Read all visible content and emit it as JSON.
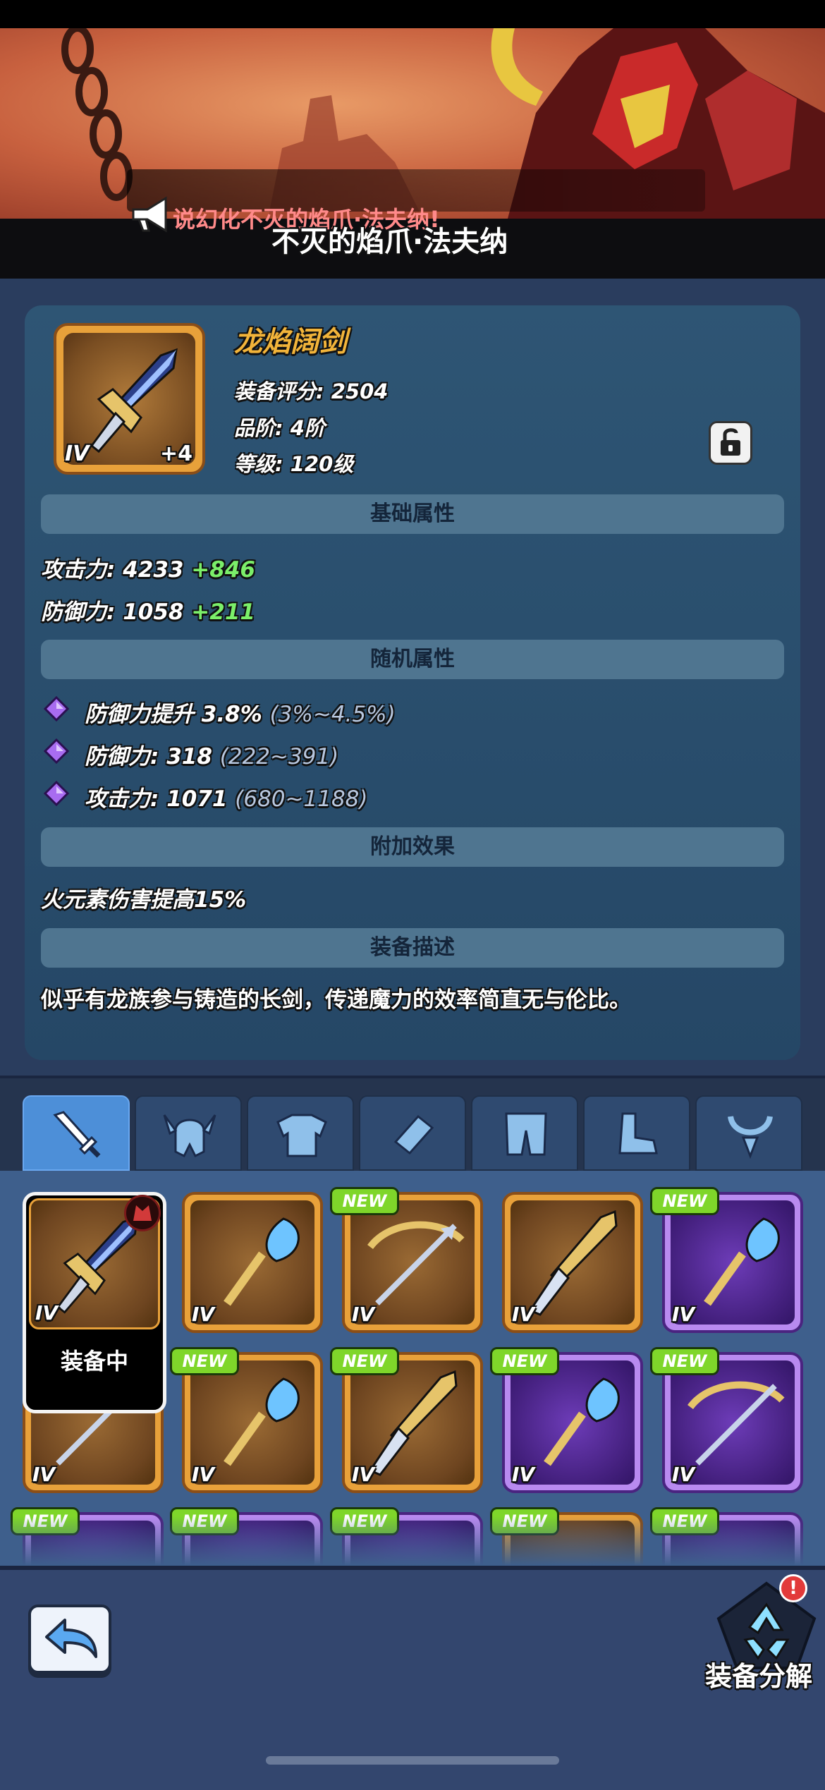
{
  "banner": {
    "announcement": "说幻化不灭的焰爪·法夫纳!",
    "subtitle": "不灭的焰爪·法夫纳"
  },
  "item": {
    "name": "龙焰阔剑",
    "tier": "IV",
    "enhance": "+4",
    "score_label": "装备评分:",
    "score_value": "2504",
    "grade_label": "品阶:",
    "grade_value": "4阶",
    "level_label": "等级:",
    "level_value": "120级",
    "icon": "sword-icon"
  },
  "sections": {
    "base": "基础属性",
    "random": "随机属性",
    "extra": "附加效果",
    "desc": "装备描述"
  },
  "base_stats": [
    {
      "label": "攻击力:",
      "value": "4233",
      "bonus": "+846"
    },
    {
      "label": "防御力:",
      "value": "1058",
      "bonus": "+211"
    }
  ],
  "random_stats": [
    {
      "text": "防御力提升 3.8%",
      "range": "(3%~4.5%)"
    },
    {
      "text": "防御力: 318",
      "range": "(222~391)"
    },
    {
      "text": "攻击力: 1071",
      "range": "(680~1188)"
    }
  ],
  "extra_effect": "火元素伤害提高15%",
  "description": "似乎有龙族参与铸造的长剑，传递魔力的效率简直无与伦比。",
  "tabs": [
    "weapon",
    "helmet",
    "armor",
    "bracer",
    "pants",
    "boots",
    "necklace"
  ],
  "grid": {
    "equipped_label": "装备中",
    "new_label": "NEW",
    "tier_label": "IV"
  },
  "bottom": {
    "salvage_label": "装备分解",
    "alert": "!"
  },
  "colors": {
    "item_name": "#f2b43a",
    "bonus_green": "#7bef6a",
    "new_badge": "#7fd62a",
    "gold_frame": "#e8a13a",
    "purple_frame": "#b98af0"
  }
}
